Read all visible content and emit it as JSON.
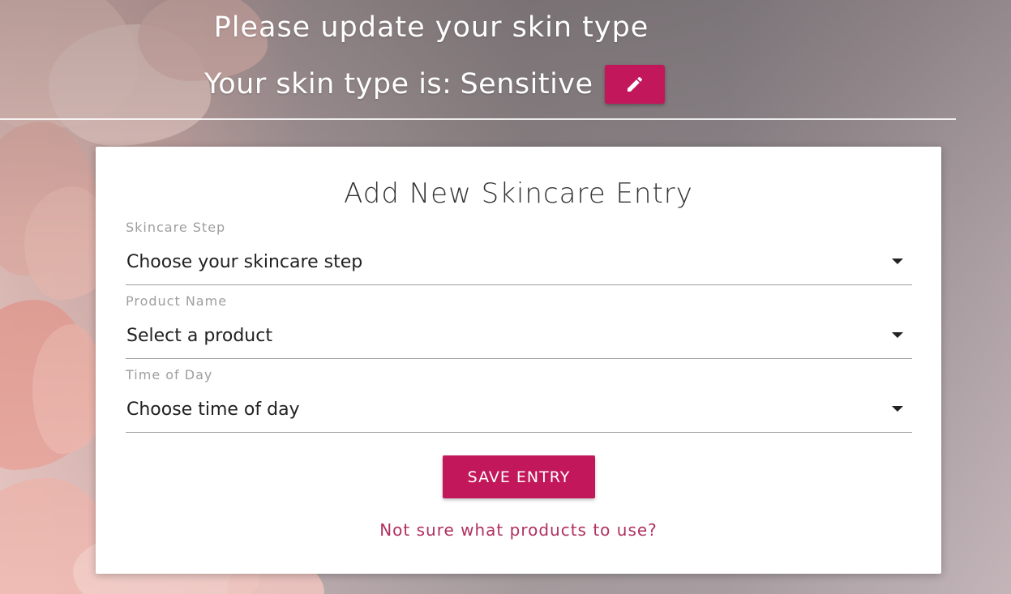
{
  "header": {
    "prompt": "Please update your skin type",
    "skin_type_label": "Your skin type is:",
    "skin_type_value": "Sensitive",
    "edit_icon": "pencil-icon"
  },
  "form": {
    "title": "Add New Skincare Entry",
    "fields": [
      {
        "label": "Skincare Step",
        "value": "Choose your skincare step"
      },
      {
        "label": "Product Name",
        "value": "Select a product"
      },
      {
        "label": "Time of Day",
        "value": "Choose time of day"
      }
    ],
    "save_label": "SAVE ENTRY",
    "help_link": "Not sure what products to use?"
  },
  "colors": {
    "accent": "#c2185b",
    "link": "#b0305f"
  }
}
